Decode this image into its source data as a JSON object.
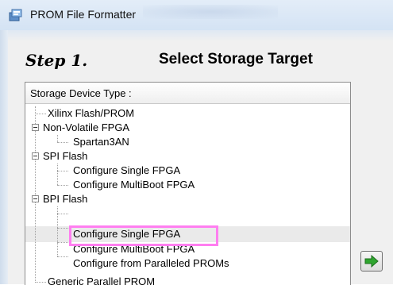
{
  "window": {
    "title": "PROM File Formatter",
    "icon": "prom-formatter-icon"
  },
  "step": {
    "label": "Step 1.",
    "title": "Select Storage Target"
  },
  "tree": {
    "header": "Storage Device Type :",
    "items": [
      {
        "label": "Xilinx Flash/PROM",
        "level": 0
      },
      {
        "label": "Non-Volatile FPGA",
        "level": 0,
        "expanded": true
      },
      {
        "label": "Spartan3AN",
        "level": 1
      },
      {
        "label": "SPI Flash",
        "level": 0,
        "expanded": true
      },
      {
        "label": "Configure Single FPGA",
        "level": 1
      },
      {
        "label": "Configure MultiBoot FPGA",
        "level": 1
      },
      {
        "label": "BPI Flash",
        "level": 0,
        "expanded": true
      },
      {
        "label": "Configure Single FPGA",
        "level": 1,
        "selected": true,
        "highlighted": true
      },
      {
        "label": "Configure MultiBoot FPGA",
        "level": 1
      },
      {
        "label": "Configure from Paralleled PROMs",
        "level": 1
      },
      {
        "label": "Generic Parallel PROM",
        "level": 0
      }
    ]
  },
  "buttons": {
    "next_icon": "right-arrow-icon"
  },
  "colors": {
    "highlight": "#ff7ef0",
    "arrow": "#2fa52f"
  }
}
